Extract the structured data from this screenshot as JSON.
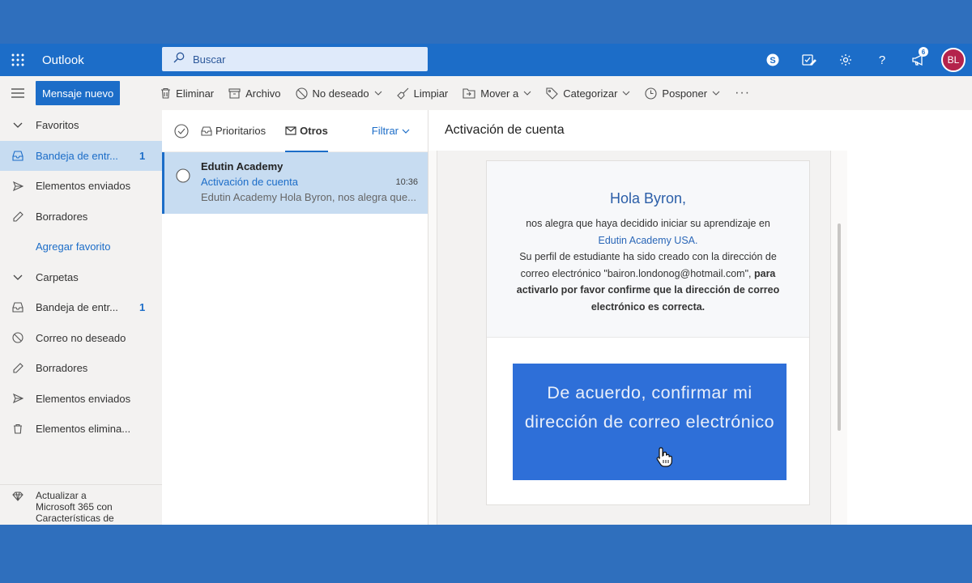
{
  "app": {
    "name": "Outlook"
  },
  "search": {
    "placeholder": "Buscar"
  },
  "topbar": {
    "notification_count": "6",
    "avatar_initials": "BL",
    "icons": [
      "skype-icon",
      "todo-icon",
      "gear-icon",
      "help-icon",
      "megaphone-icon"
    ]
  },
  "toolbar": {
    "new_message": "Mensaje nuevo",
    "delete": "Eliminar",
    "archive": "Archivo",
    "junk": "No deseado",
    "sweep": "Limpiar",
    "move": "Mover a",
    "categorize": "Categorizar",
    "snooze": "Posponer",
    "more": "···"
  },
  "nav": {
    "favorites_header": "Favoritos",
    "favorites": [
      {
        "label": "Bandeja de entr...",
        "count": "1"
      },
      {
        "label": "Elementos enviados",
        "count": ""
      },
      {
        "label": "Borradores",
        "count": ""
      }
    ],
    "add_favorite": "Agregar favorito",
    "folders_header": "Carpetas",
    "folders": [
      {
        "label": "Bandeja de entr...",
        "count": "1"
      },
      {
        "label": "Correo no deseado",
        "count": ""
      },
      {
        "label": "Borradores",
        "count": ""
      },
      {
        "label": "Elementos enviados",
        "count": ""
      },
      {
        "label": "Elementos elimina...",
        "count": ""
      }
    ],
    "upgrade_text": "Actualizar a Microsoft 365 con Características de"
  },
  "list": {
    "tab_focused": "Prioritarios",
    "tab_other": "Otros",
    "filter": "Filtrar",
    "messages": [
      {
        "from": "Edutin Academy",
        "subject": "Activación de cuenta",
        "time": "10:36",
        "preview": "Edutin Academy Hola Byron, nos alegra que..."
      }
    ]
  },
  "reading": {
    "title": "Activación de cuenta",
    "greeting": "Hola Byron,",
    "line1": "nos alegra que haya decidido iniciar su aprendizaje en",
    "org_link": "Edutin Academy USA.",
    "line2": "Su perfil de estudiante ha sido creado con la dirección de",
    "line3_prefix": "correo electrónico \"bairon.londonog@hotmail.com\",",
    "line3_bold": "para",
    "line4_bold": "activarlo por favor confirme que la dirección de correo",
    "line5_bold": "electrónico es correcta.",
    "cta": "De acuerdo, confirmar mi dirección de correo electrónico"
  },
  "colors": {
    "brand": "#1c6dc8",
    "avatar": "#b4234c",
    "cta": "#2e6fd8",
    "selected_row": "#c7dcf1"
  }
}
